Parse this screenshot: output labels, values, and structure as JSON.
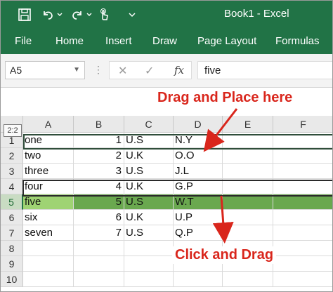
{
  "window": {
    "title": "Book1  -  Excel"
  },
  "quick_access": {
    "icons": [
      "save-icon",
      "undo-icon",
      "undo-dropdown-icon",
      "redo-icon",
      "redo-dropdown-icon",
      "touch-mode-icon",
      "customize-icon"
    ]
  },
  "ribbon": {
    "tabs": [
      {
        "label": "File"
      },
      {
        "label": "Home"
      },
      {
        "label": "Insert"
      },
      {
        "label": "Draw"
      },
      {
        "label": "Page Layout"
      },
      {
        "label": "Formulas"
      }
    ]
  },
  "formula_bar": {
    "name_box": "A5",
    "cancel_glyph": "✕",
    "enter_glyph": "✓",
    "fx_label": "fx",
    "value": "five"
  },
  "grid": {
    "columns": [
      "A",
      "B",
      "C",
      "D",
      "E",
      "F"
    ],
    "rows": [
      {
        "num": "1",
        "a": "one",
        "b": "1",
        "c": "U.S",
        "d": "N.Y"
      },
      {
        "num": "2",
        "a": "two",
        "b": "2",
        "c": "U.K",
        "d": "O.O"
      },
      {
        "num": "3",
        "a": "three",
        "b": "3",
        "c": "U.S",
        "d": "J.L"
      },
      {
        "num": "4",
        "a": "four",
        "b": "4",
        "c": "U.K",
        "d": "G.P"
      },
      {
        "num": "5",
        "a": "five",
        "b": "5",
        "c": "U.S",
        "d": "W.T"
      },
      {
        "num": "6",
        "a": "six",
        "b": "6",
        "c": "U.K",
        "d": "U.P"
      },
      {
        "num": "7",
        "a": "seven",
        "b": "7",
        "c": "U.S",
        "d": "Q.P"
      },
      {
        "num": "8",
        "a": "",
        "b": "",
        "c": "",
        "d": ""
      },
      {
        "num": "9",
        "a": "",
        "b": "",
        "c": "",
        "d": ""
      },
      {
        "num": "10",
        "a": "",
        "b": "",
        "c": "",
        "d": ""
      }
    ],
    "selected_row": "5",
    "drag_tooltip": "2:2"
  },
  "annotations": {
    "top": "Drag and Place here",
    "bottom": "Click and Drag",
    "color": "#d9261c"
  },
  "colors": {
    "excel_green": "#217346",
    "selection_fill": "#6aa84f",
    "active_cell_fill": "#9fd373"
  }
}
